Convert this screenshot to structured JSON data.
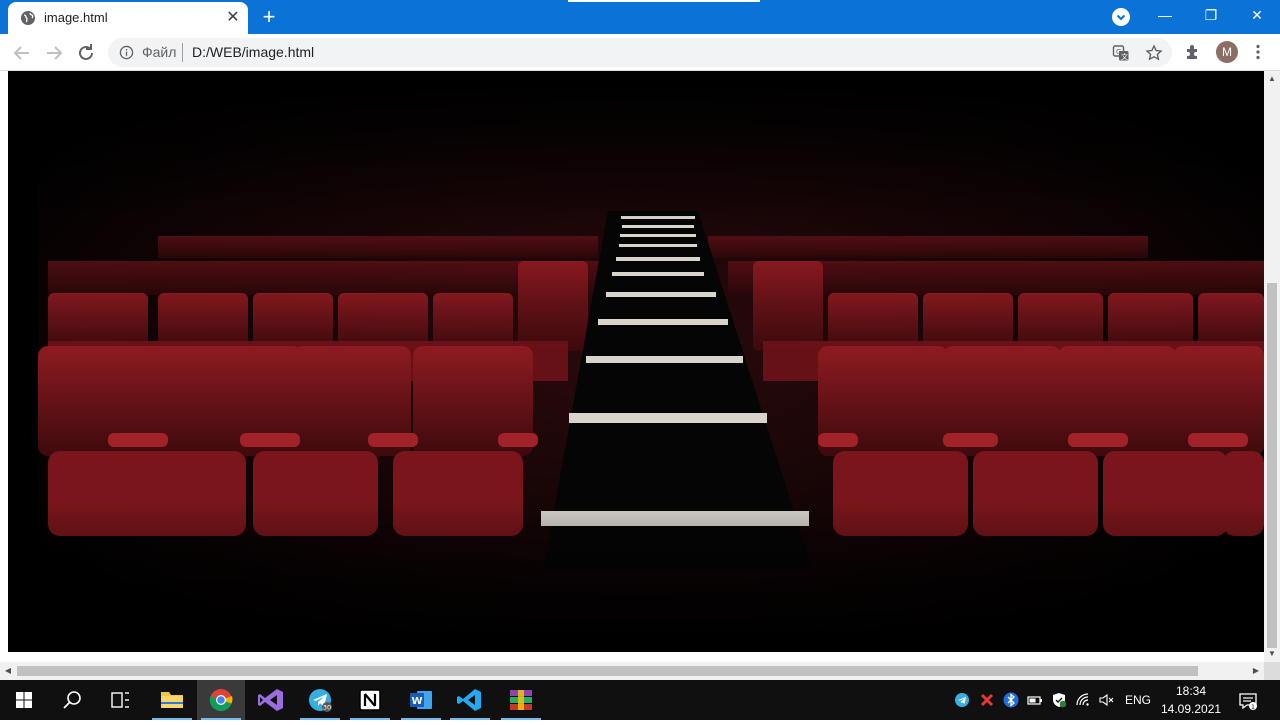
{
  "browser": {
    "tab": {
      "title": "image.html",
      "close_glyph": "✕"
    },
    "new_tab_glyph": "+",
    "window_controls": {
      "minimize": "—",
      "restore": "❐",
      "close": "✕"
    },
    "address": {
      "scheme_label": "Файл",
      "url": "D:/WEB/image.html"
    },
    "profile_initial": "M"
  },
  "page": {
    "image_alt": "theater",
    "image_subject": "empty cinema hall with red seats and lit aisle steps"
  },
  "taskbar": {
    "apps": [
      {
        "name": "start",
        "icon": "windows-icon"
      },
      {
        "name": "search",
        "icon": "search-icon"
      },
      {
        "name": "task-view",
        "icon": "task-view-icon"
      },
      {
        "name": "file-explorer",
        "icon": "folder-icon"
      },
      {
        "name": "chrome",
        "icon": "chrome-icon"
      },
      {
        "name": "visual-studio",
        "icon": "visual-studio-icon"
      },
      {
        "name": "telegram",
        "icon": "telegram-icon",
        "badge": "30"
      },
      {
        "name": "notion",
        "icon": "notion-icon"
      },
      {
        "name": "word",
        "icon": "word-icon"
      },
      {
        "name": "vscode",
        "icon": "vscode-icon"
      },
      {
        "name": "winrar",
        "icon": "winrar-icon"
      }
    ],
    "tray": {
      "language": "ENG",
      "time": "18:34",
      "date": "14.09.2021",
      "notification_count": "1"
    }
  },
  "colors": {
    "titlebar": "#0b73d6",
    "seat_red": "#8b1a1f",
    "step_light": "#d8d4cc"
  }
}
